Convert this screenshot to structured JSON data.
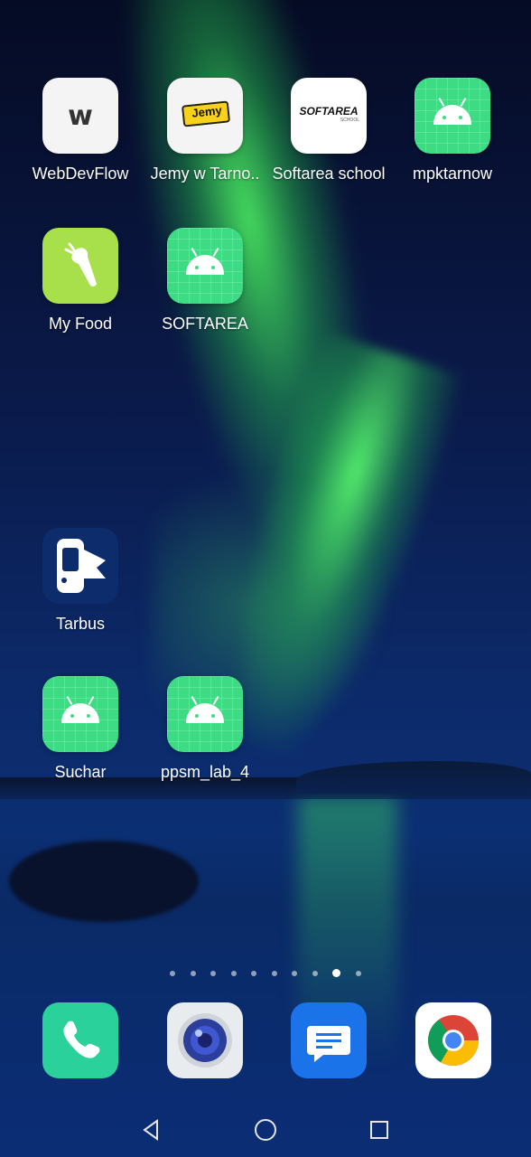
{
  "apps": [
    {
      "label": "WebDevFlow"
    },
    {
      "label": "Jemy w Tarno.."
    },
    {
      "label": "Softarea school"
    },
    {
      "label": "mpktarnow"
    },
    {
      "label": "My Food"
    },
    {
      "label": "SOFTAREA"
    },
    {
      "label": "Tarbus"
    },
    {
      "label": "Suchar"
    },
    {
      "label": "ppsm_lab_4"
    }
  ],
  "icon_text": {
    "webdevflow": "w",
    "jemy": "Jemy",
    "softarea_school": "SOFTAREA",
    "softarea_school_sub": "SCHOOL"
  },
  "page_indicator": {
    "count": 10,
    "active_index": 8
  },
  "dock": [
    {
      "name": "phone-icon"
    },
    {
      "name": "camera-icon"
    },
    {
      "name": "messages-icon"
    },
    {
      "name": "chrome-icon"
    }
  ],
  "navigation": {
    "back": "back-icon",
    "home": "home-icon",
    "recents": "recents-icon"
  },
  "colors": {
    "android_green": "#3ddc84",
    "myfood_green": "#a7e04a",
    "messages_blue": "#1a73e8",
    "phone_green": "#2bd19a"
  }
}
